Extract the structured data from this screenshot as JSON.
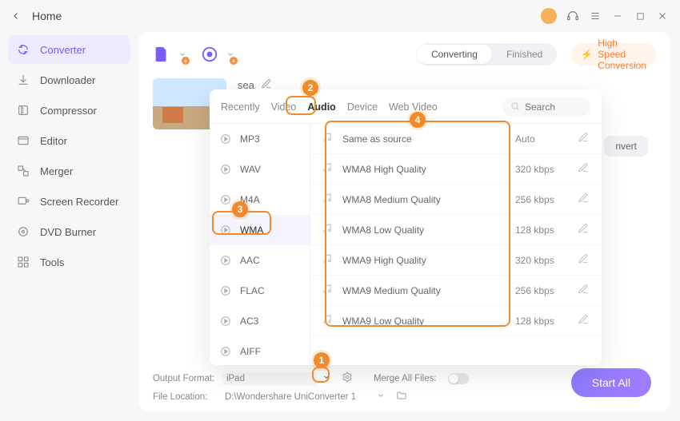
{
  "nav": {
    "home": "Home"
  },
  "sidebar": {
    "items": [
      {
        "label": "Converter"
      },
      {
        "label": "Downloader"
      },
      {
        "label": "Compressor"
      },
      {
        "label": "Editor"
      },
      {
        "label": "Merger"
      },
      {
        "label": "Screen Recorder"
      },
      {
        "label": "DVD Burner"
      },
      {
        "label": "Tools"
      }
    ]
  },
  "header": {
    "segments": {
      "converting": "Converting",
      "finished": "Finished"
    },
    "highspeed": "High Speed Conversion"
  },
  "file": {
    "name": "sea"
  },
  "convert_btn": "nvert",
  "panel": {
    "tabs": {
      "recently": "Recently",
      "video": "Video",
      "audio": "Audio",
      "device": "Device",
      "webvideo": "Web Video"
    },
    "search_placeholder": "Search",
    "formats": [
      "MP3",
      "WAV",
      "M4A",
      "WMA",
      "AAC",
      "FLAC",
      "AC3",
      "AIFF"
    ],
    "selected_format_index": 3,
    "qualities": [
      {
        "label": "Same as source",
        "bitrate": "Auto"
      },
      {
        "label": "WMA8 High Quality",
        "bitrate": "320 kbps"
      },
      {
        "label": "WMA8 Medium Quality",
        "bitrate": "256 kbps"
      },
      {
        "label": "WMA8 Low Quality",
        "bitrate": "128 kbps"
      },
      {
        "label": "WMA9 High Quality",
        "bitrate": "320 kbps"
      },
      {
        "label": "WMA9 Medium Quality",
        "bitrate": "256 kbps"
      },
      {
        "label": "WMA9 Low Quality",
        "bitrate": "128 kbps"
      }
    ]
  },
  "bottom": {
    "output_format_label": "Output Format:",
    "output_format_value": "iPad",
    "file_location_label": "File Location:",
    "file_location_value": "D:\\Wondershare UniConverter 1",
    "merge_label": "Merge All Files:",
    "start_all": "Start All"
  },
  "callouts": {
    "c1": "1",
    "c2": "2",
    "c3": "3",
    "c4": "4"
  }
}
